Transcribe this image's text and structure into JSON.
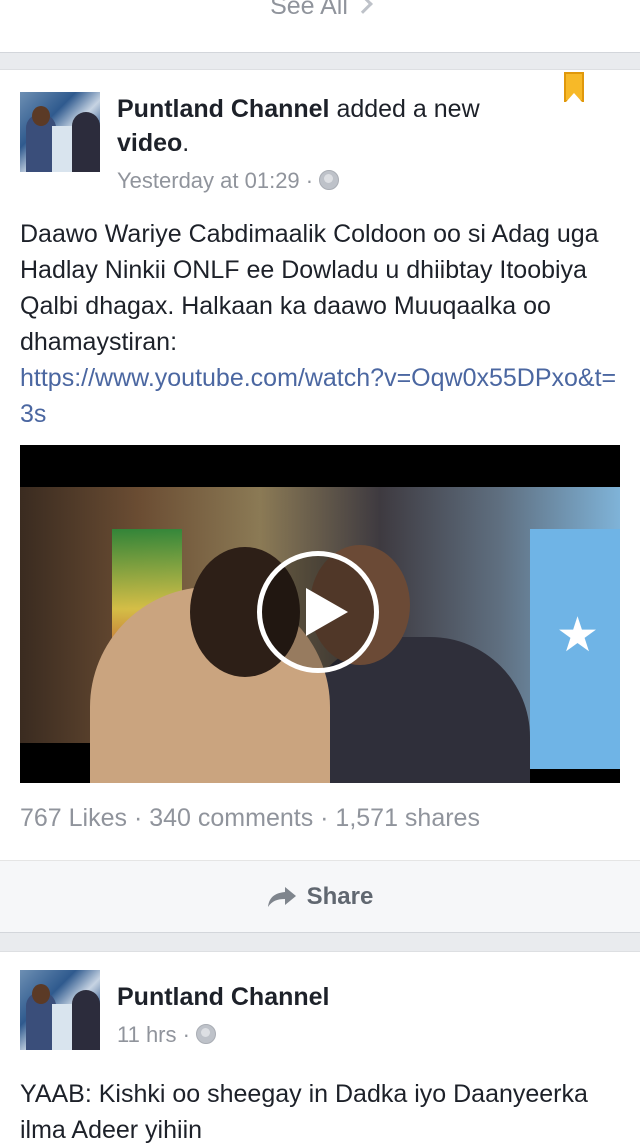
{
  "top": {
    "see_all": "See All"
  },
  "post1": {
    "author_name": "Puntland Channel",
    "author_action": " added a new ",
    "author_object": "video",
    "author_suffix": ".",
    "time": "Yesterday at 01:29 ·",
    "body": "Daawo Wariye Cabdimaalik Coldoon oo si Adag uga Hadlay Ninkii ONLF ee Dowladu u dhiibtay Itoobiya Qalbi dhagax. Halkaan ka daawo Muuqaalka oo dhamaystiran:",
    "link": "https://www.youtube.com/watch?v=Oqw0x55DPxo&t=3s",
    "stats": "767 Likes · 340 comments · 1,571 shares",
    "share_label": "Share"
  },
  "post2": {
    "author_name": "Puntland Channel",
    "time": "11 hrs ·",
    "body": "YAAB: Kishki oo sheegay in Dadka iyo Daanyeerka ilma Adeer yihiin"
  },
  "colors": {
    "link": "#4b67a1",
    "muted": "#90949c",
    "bookmark": "#f7b928"
  }
}
